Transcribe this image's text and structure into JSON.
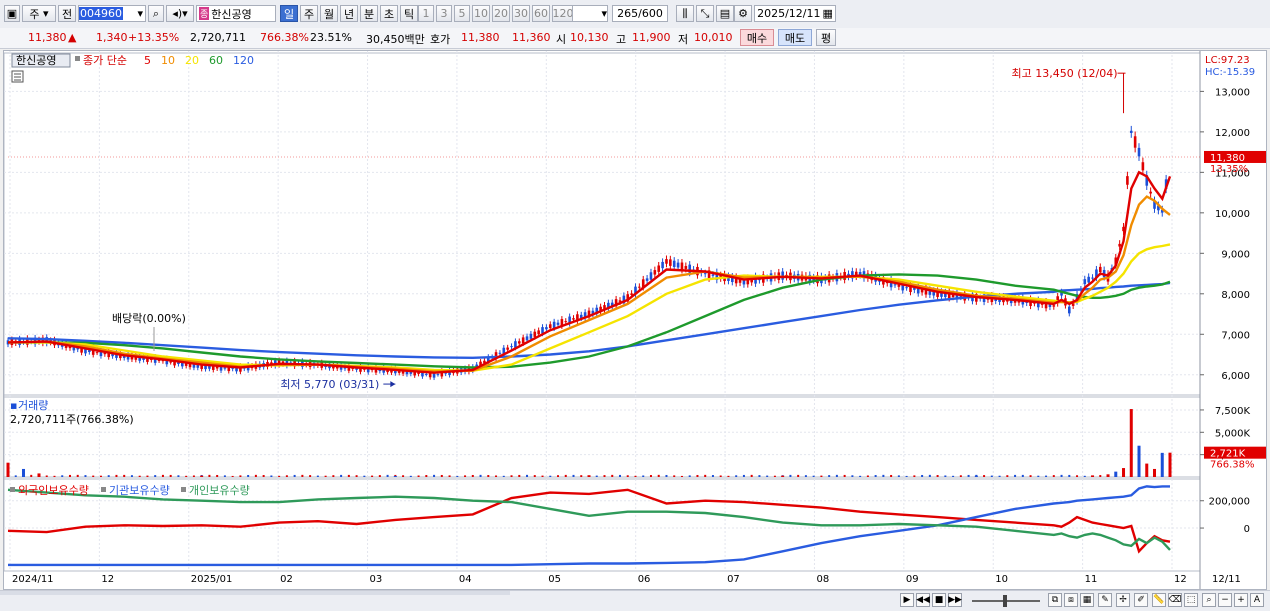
{
  "toolbar": {
    "period_type": "주",
    "prev_label": "전",
    "code": "004960",
    "stock_name": "한신공영",
    "name_badge": "종",
    "periods": [
      "일",
      "주",
      "월",
      "년",
      "분",
      "초",
      "틱"
    ],
    "active_period": "일",
    "intervals": [
      "1",
      "3",
      "5",
      "10",
      "20",
      "30",
      "60",
      "120"
    ],
    "count": "265",
    "count_total": "/600",
    "date": "2025/12/11"
  },
  "quote": {
    "price": "11,380",
    "arrow": "▲",
    "change": "1,340",
    "change_pct": "+13.35%",
    "volume": "2,720,711",
    "volume_ratio": "766.38%",
    "turnover": "23.51%",
    "amount": "30,450백만",
    "ask_label": "호가",
    "ask": "11,380",
    "bid": "11,360",
    "open_label": "시",
    "open": "10,130",
    "high_label": "고",
    "high": "11,900",
    "low_label": "저",
    "low": "10,010",
    "buy_label": "매수",
    "sell_label": "매도",
    "eval_label": "평"
  },
  "price_panel": {
    "name_tag": "한신공영",
    "ma_title": "종가 단순",
    "ma_periods": [
      "5",
      "10",
      "20",
      "60",
      "120"
    ],
    "lc_label": "LC:97.23",
    "hc_label": "HC:-15.39",
    "last_price_tag": "11,380",
    "last_pct_tag": "13.35%",
    "high_annot": "최고 13,450 (12/04)",
    "low_annot": "최저 5,770 (03/31)",
    "div_annot": "배당락(0.00%)"
  },
  "volume_panel": {
    "title": "거래량",
    "value": "2,720,711주(766.38%)",
    "last_tag": "2,721K",
    "last_pct": "766.38%"
  },
  "holding_panel": {
    "legend": [
      "외국인보유수량",
      "기관보유수량",
      "개인보유수량"
    ]
  },
  "colors": {
    "up": "#e00000",
    "down": "#1b4fd8",
    "ma5": "#e00000",
    "ma10": "#f08c00",
    "ma20": "#f5e400",
    "ma60": "#1e9a2c",
    "ma120": "#2a5ce0",
    "foreign": "#e00000",
    "institution": "#2a5ce0",
    "individual": "#2f9a5a"
  },
  "chart_data": [
    {
      "type": "line",
      "title": "한신공영",
      "ylabel": "",
      "ylim": [
        5500,
        13800
      ],
      "yticks": [
        "6,000",
        "7,000",
        "8,000",
        "9,000",
        "10,000",
        "11,000",
        "12,000",
        "13,000"
      ],
      "ytick_values": [
        6000,
        7000,
        8000,
        9000,
        10000,
        11000,
        12000,
        13000
      ],
      "x_labels": [
        "2024/11",
        "12",
        "2025/01",
        "02",
        "03",
        "04",
        "05",
        "06",
        "07",
        "08",
        "09",
        "10",
        "11",
        "12",
        "12/11"
      ],
      "x": [
        0,
        10,
        20,
        30,
        40,
        50,
        60,
        70,
        80,
        90,
        100,
        110,
        120,
        130,
        140,
        150,
        160,
        170,
        180,
        190,
        200,
        210,
        220,
        230,
        240,
        250,
        260,
        270,
        272,
        274,
        276,
        278,
        280,
        282,
        284,
        286,
        288,
        290,
        292,
        294,
        296,
        298,
        300
      ],
      "close": [
        6800,
        6850,
        6600,
        6450,
        6350,
        6200,
        6150,
        6300,
        6250,
        6150,
        6100,
        6000,
        6150,
        6700,
        7200,
        7500,
        7900,
        8800,
        8500,
        8300,
        8450,
        8350,
        8500,
        8200,
        8000,
        7900,
        7850,
        7700,
        8000,
        7600,
        7900,
        8300,
        8400,
        8600,
        8400,
        8800,
        9600,
        12000,
        11500,
        10800,
        10200,
        10040,
        11380
      ],
      "series": [
        {
          "name": "5",
          "values": [
            6800,
            6820,
            6650,
            6480,
            6380,
            6250,
            6180,
            6270,
            6250,
            6180,
            6120,
            6050,
            6120,
            6600,
            7100,
            7450,
            7850,
            8600,
            8550,
            8350,
            8420,
            8380,
            8450,
            8250,
            8050,
            7920,
            7850,
            7750,
            7850,
            7750,
            7850,
            8150,
            8300,
            8500,
            8450,
            8700,
            9300,
            10600,
            11000,
            10900,
            10600,
            10350,
            10900
          ]
        },
        {
          "name": "10",
          "values": [
            6800,
            6820,
            6700,
            6520,
            6400,
            6300,
            6200,
            6250,
            6250,
            6200,
            6150,
            6080,
            6100,
            6450,
            6950,
            7350,
            7750,
            8400,
            8550,
            8400,
            8420,
            8400,
            8430,
            8300,
            8100,
            7950,
            7880,
            7780,
            7800,
            7780,
            7820,
            8000,
            8150,
            8350,
            8400,
            8550,
            8950,
            9700,
            10200,
            10400,
            10300,
            10100,
            9950
          ]
        },
        {
          "name": "20",
          "values": [
            6800,
            6800,
            6750,
            6600,
            6450,
            6350,
            6250,
            6230,
            6250,
            6220,
            6180,
            6120,
            6100,
            6250,
            6650,
            7050,
            7450,
            8000,
            8350,
            8450,
            8420,
            8420,
            8420,
            8350,
            8200,
            8050,
            7930,
            7830,
            7800,
            7790,
            7800,
            7880,
            7950,
            8050,
            8150,
            8300,
            8500,
            8800,
            9000,
            9100,
            9150,
            9180,
            9220
          ]
        },
        {
          "name": "60",
          "values": [
            6800,
            6800,
            6790,
            6730,
            6650,
            6550,
            6450,
            6380,
            6330,
            6290,
            6250,
            6210,
            6180,
            6200,
            6300,
            6450,
            6700,
            7050,
            7450,
            7850,
            8150,
            8350,
            8450,
            8480,
            8450,
            8350,
            8200,
            8100,
            8050,
            8000,
            7950,
            7920,
            7900,
            7900,
            7920,
            7950,
            8000,
            8100,
            8150,
            8180,
            8200,
            8230,
            8300
          ]
        },
        {
          "name": "120",
          "values": [
            6900,
            6880,
            6840,
            6790,
            6730,
            6670,
            6610,
            6560,
            6520,
            6480,
            6450,
            6430,
            6420,
            6450,
            6500,
            6580,
            6700,
            6850,
            7000,
            7150,
            7300,
            7450,
            7600,
            7730,
            7840,
            7930,
            8000,
            8050,
            8080,
            8090,
            8100,
            8110,
            8120,
            8140,
            8150,
            8170,
            8180,
            8200,
            8210,
            8220,
            8230,
            8240,
            8270
          ]
        }
      ],
      "high_marker": {
        "x": 288,
        "value": 13450
      },
      "low_marker": {
        "x": 100,
        "value": 5770
      }
    },
    {
      "type": "bar",
      "title": "거래량",
      "ylim": [
        0,
        8500000
      ],
      "yticks": [
        "2,500K",
        "5,000K",
        "7,500K"
      ],
      "ytick_values": [
        2500000,
        5000000,
        7500000
      ],
      "x": [
        0,
        4,
        8,
        50,
        100,
        150,
        200,
        250,
        280,
        284,
        286,
        288,
        290,
        292,
        294,
        296,
        298,
        300
      ],
      "values": [
        1600000,
        900000,
        400000,
        150000,
        120000,
        200000,
        150000,
        150000,
        180000,
        300000,
        600000,
        1000000,
        7600000,
        3500000,
        1500000,
        900000,
        2700000,
        2720711
      ]
    },
    {
      "type": "line",
      "title": "보유수량",
      "ylim": [
        -300000,
        330000
      ],
      "yticks": [
        "0",
        "200,000"
      ],
      "ytick_values": [
        0,
        200000
      ],
      "x": [
        0,
        10,
        20,
        30,
        40,
        50,
        60,
        70,
        80,
        90,
        100,
        110,
        120,
        130,
        140,
        150,
        160,
        170,
        180,
        190,
        200,
        210,
        220,
        230,
        240,
        250,
        260,
        270,
        272,
        274,
        276,
        278,
        280,
        282,
        284,
        286,
        288,
        290,
        292,
        294,
        296,
        298,
        300
      ],
      "series": [
        {
          "name": "외국인보유수량",
          "values": [
            -20000,
            -30000,
            10000,
            20000,
            15000,
            20000,
            10000,
            40000,
            50000,
            30000,
            60000,
            80000,
            100000,
            220000,
            260000,
            250000,
            280000,
            180000,
            200000,
            190000,
            170000,
            150000,
            120000,
            100000,
            80000,
            60000,
            40000,
            20000,
            10000,
            40000,
            80000,
            60000,
            40000,
            30000,
            20000,
            10000,
            0,
            15000,
            -170000,
            -110000,
            -60000,
            -90000,
            -100000
          ]
        },
        {
          "name": "기관보유수량",
          "values": [
            -270000,
            -270000,
            -270000,
            -270000,
            -270000,
            -270000,
            -270000,
            -270000,
            -270000,
            -270000,
            -270000,
            -270000,
            -270000,
            -270000,
            -265000,
            -260000,
            -260000,
            -255000,
            -250000,
            -230000,
            -170000,
            -110000,
            -60000,
            -20000,
            20000,
            80000,
            140000,
            180000,
            185000,
            190000,
            200000,
            205000,
            210000,
            215000,
            220000,
            225000,
            230000,
            240000,
            290000,
            305000,
            300000,
            305000,
            305000
          ]
        },
        {
          "name": "개인보유수량",
          "values": [
            280000,
            260000,
            240000,
            230000,
            210000,
            200000,
            190000,
            190000,
            210000,
            220000,
            230000,
            220000,
            200000,
            190000,
            140000,
            90000,
            120000,
            120000,
            110000,
            80000,
            40000,
            20000,
            20000,
            30000,
            20000,
            10000,
            -20000,
            -50000,
            -40000,
            -60000,
            -70000,
            -50000,
            -40000,
            -50000,
            -70000,
            -90000,
            -120000,
            -130000,
            -80000,
            -110000,
            -70000,
            -100000,
            -160000
          ]
        }
      ]
    }
  ]
}
